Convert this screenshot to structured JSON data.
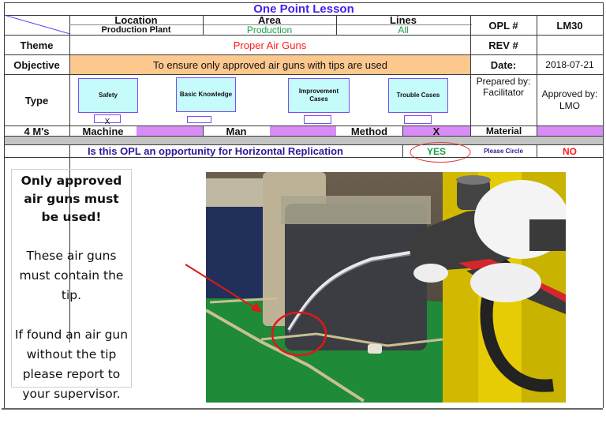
{
  "header": {
    "title": "One Point Lesson",
    "location_label": "Location",
    "location_value": "Production Plant",
    "area_label": "Area",
    "area_value": "Production",
    "lines_label": "Lines",
    "lines_value": "All",
    "opl_label": "OPL #",
    "opl_value": "LM30",
    "rev_label": "REV #",
    "rev_value": ""
  },
  "theme": {
    "label": "Theme",
    "value": "Proper Air Guns"
  },
  "objective": {
    "label": "Objective",
    "value": "To ensure only approved air guns with tips are used"
  },
  "date": {
    "label": "Date:",
    "value": "2018-07-21"
  },
  "type": {
    "label": "Type",
    "options": [
      {
        "label": "Safety",
        "checked_mark": "X"
      },
      {
        "label": "Basic Knowledge",
        "checked_mark": ""
      },
      {
        "label": "Improvement Cases",
        "checked_mark": ""
      },
      {
        "label": "Trouble Cases",
        "checked_mark": ""
      }
    ],
    "prepared_by_label": "Prepared by:",
    "prepared_by_value": "Facilitator",
    "approved_by_label": "Approved by:",
    "approved_by_value": "LMO"
  },
  "four_ms": {
    "label": "4 M's",
    "machine": "Machine",
    "man": "Man",
    "method": "Method",
    "method_mark": "X",
    "material": "Material"
  },
  "replication": {
    "question": "Is this OPL an opportunity for Horizontal Replication",
    "yes": "YES",
    "instruction": "Please Circle",
    "no": "NO",
    "selected": "YES"
  },
  "notice": {
    "heading": "Only approved air guns must be used!",
    "paragraph1": "These air guns must contain the tip.",
    "paragraph2": "If found an air gun without the tip please report to your supervisor."
  },
  "colors": {
    "title": "#4a1ff0",
    "area_value": "#1aa04a",
    "theme_value": "#ff1a1a",
    "objective_bg": "#fcc88d",
    "type_box_bg": "#c6fbfc",
    "four_ms_fill": "#d98cf7",
    "yes": "#1aa04a",
    "no": "#ff1a1a",
    "question": "#2a1a9a"
  }
}
